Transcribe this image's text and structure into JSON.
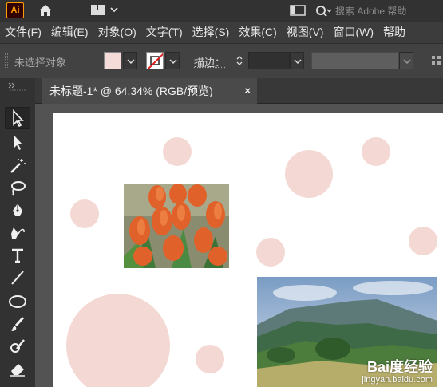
{
  "app": {
    "logo_text": "Ai",
    "search_placeholder": "搜索 Adobe 帮助"
  },
  "menu": [
    "文件(F)",
    "编辑(E)",
    "对象(O)",
    "文字(T)",
    "选择(S)",
    "效果(C)",
    "视图(V)",
    "窗口(W)",
    "帮助"
  ],
  "control_bar": {
    "selection_status": "未选择对象",
    "fill_color": "#f6dcd8",
    "stroke_label": "描边："
  },
  "tab": {
    "title": "未标题-1* @ 64.34% (RGB/预览)",
    "close": "×"
  },
  "tools": [
    "selection-tool",
    "direct-selection-tool",
    "magic-wand-tool",
    "lasso-tool",
    "pen-tool",
    "curvature-tool",
    "type-tool",
    "line-segment-tool",
    "ellipse-tool",
    "paintbrush-tool",
    "shaper-tool",
    "eraser-tool"
  ],
  "canvas": {
    "dot_color": "#f4d8d3",
    "images": [
      "tulips-photo",
      "mountain-landscape-photo"
    ]
  },
  "watermark": {
    "brand": "Bai度经验",
    "url": "jingyan.baidu.com"
  }
}
